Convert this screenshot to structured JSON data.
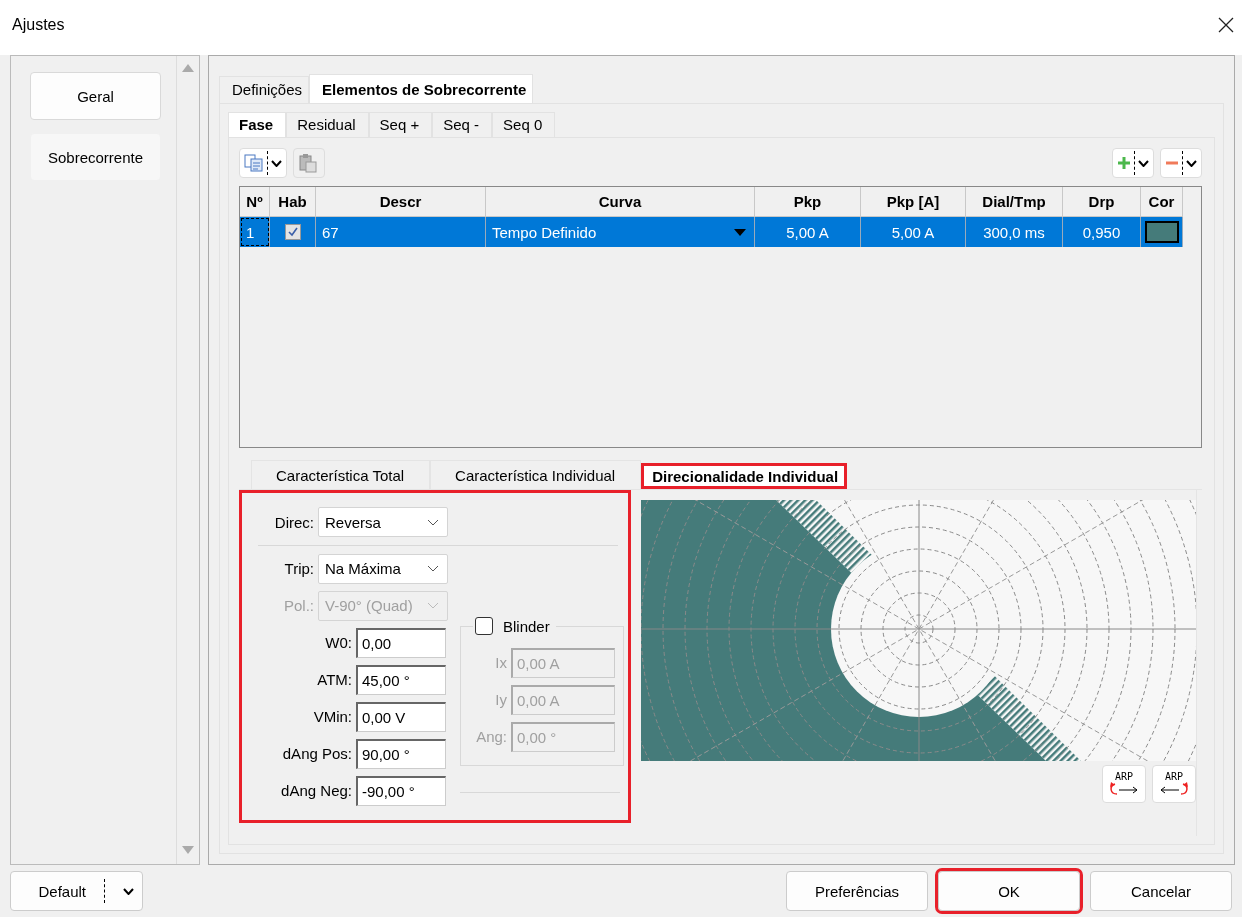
{
  "window": {
    "title": "Ajustes"
  },
  "sidebar": {
    "items": [
      {
        "label": "Geral",
        "selected": false
      },
      {
        "label": "Sobrecorrente",
        "selected": true
      }
    ]
  },
  "tabs": [
    {
      "label": "Definições",
      "selected": false
    },
    {
      "label": "Elementos de Sobrecorrente",
      "selected": true
    }
  ],
  "subtabs": [
    {
      "label": "Fase",
      "selected": true
    },
    {
      "label": "Residual",
      "selected": false
    },
    {
      "label": "Seq +",
      "selected": false
    },
    {
      "label": "Seq -",
      "selected": false
    },
    {
      "label": "Seq 0",
      "selected": false
    }
  ],
  "table": {
    "columns": [
      "Nº",
      "Hab",
      "Descr",
      "Curva",
      "Pkp",
      "Pkp [A]",
      "Dial/Tmp",
      "Drp",
      "Cor"
    ],
    "rows": [
      {
        "number": "1",
        "enabled": true,
        "descr": "67",
        "curva": "Tempo Definido",
        "pkp": "5,00 A",
        "pkp_a": "5,00 A",
        "dial": "300,0 ms",
        "drp": "0,950",
        "color": "#457b7a",
        "selected": true
      }
    ]
  },
  "lower_tabs": [
    {
      "label": "Característica Total",
      "selected": false,
      "highlighted": false
    },
    {
      "label": "Característica Individual",
      "selected": false,
      "highlighted": false
    },
    {
      "label": "Direcionalidade Individual",
      "selected": true,
      "highlighted": true
    }
  ],
  "direction_panel": {
    "highlighted": true,
    "direc": {
      "label": "Direc:",
      "value": "Reversa",
      "disabled": false
    },
    "trip": {
      "label": "Trip:",
      "value": "Na Máxima",
      "disabled": false
    },
    "pol": {
      "label": "Pol.:",
      "value": "V-90° (Quad)",
      "disabled": true
    },
    "fields": [
      {
        "label": "W0:",
        "value": "0,00",
        "disabled": false
      },
      {
        "label": "ATM:",
        "value": "45,00 °",
        "disabled": false
      },
      {
        "label": "VMin:",
        "value": "0,00 V",
        "disabled": false
      },
      {
        "label": "dAng Pos:",
        "value": "90,00 °",
        "disabled": false
      },
      {
        "label": "dAng Neg:",
        "value": "-90,00 °",
        "disabled": false
      }
    ],
    "blinder": {
      "label": "Blinder",
      "checked": false,
      "fields": [
        {
          "label": "Ix",
          "value": "0,00 A",
          "disabled": true
        },
        {
          "label": "Iy",
          "value": "0,00 A",
          "disabled": true
        },
        {
          "label": "Ang:",
          "value": "0,00 °",
          "disabled": true
        }
      ]
    }
  },
  "plot_buttons": [
    {
      "label": "ARP",
      "kind": "left"
    },
    {
      "label": "ARP",
      "kind": "right"
    }
  ],
  "footer": {
    "default_button": "Default",
    "buttons": [
      {
        "label": "Preferências",
        "highlighted": false
      },
      {
        "label": "OK",
        "highlighted": true
      },
      {
        "label": "Cancelar",
        "highlighted": false
      }
    ]
  }
}
